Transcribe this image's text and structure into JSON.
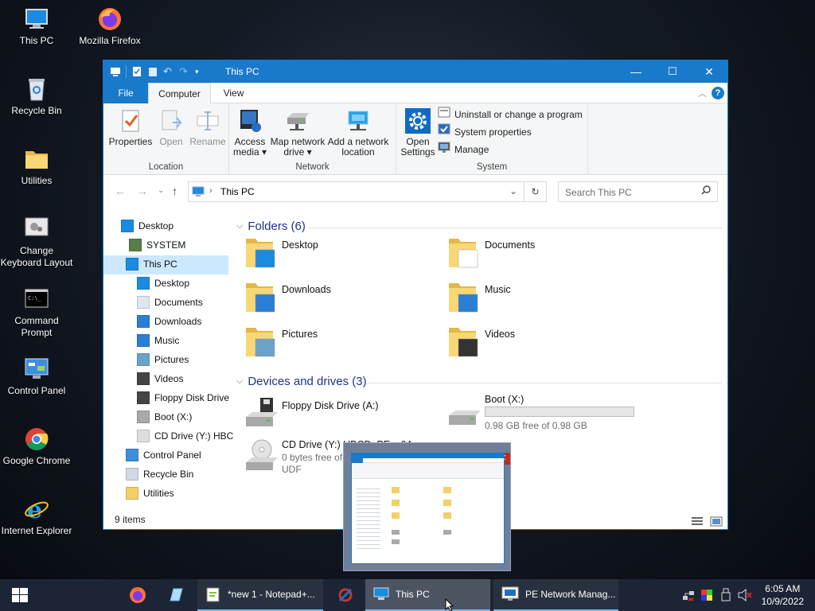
{
  "desktop": {
    "icons": [
      {
        "label": "This PC",
        "icon": "computer-icon"
      },
      {
        "label": "Mozilla Firefox",
        "icon": "firefox-icon"
      },
      {
        "label": "Recycle Bin",
        "icon": "recycle-bin-icon"
      },
      {
        "label": "Utilities",
        "icon": "folder-icon"
      },
      {
        "label": "Change Keyboard Layout",
        "icon": "keyboard-layout-icon"
      },
      {
        "label": "Command Prompt",
        "icon": "cmd-icon"
      },
      {
        "label": "Control Panel",
        "icon": "control-panel-icon"
      },
      {
        "label": "Google Chrome",
        "icon": "chrome-icon"
      },
      {
        "label": "Internet Explorer",
        "icon": "ie-icon"
      }
    ]
  },
  "window": {
    "title": "This PC",
    "controls": {
      "minimize": "—",
      "maximize": "☐",
      "close": "✕"
    },
    "tabs": {
      "file": "File",
      "computer": "Computer",
      "view": "View"
    },
    "ribbon": {
      "location": {
        "name": "Location",
        "properties": "Properties",
        "open": "Open",
        "rename": "Rename"
      },
      "network": {
        "name": "Network",
        "access_media": "Access",
        "access_media_2": "media",
        "map_drive": "Map network",
        "map_drive_2": "drive",
        "add_location": "Add a network",
        "add_location_2": "location"
      },
      "system": {
        "name": "System",
        "open_settings": "Open",
        "open_settings_2": "Settings",
        "uninstall": "Uninstall or change a program",
        "system_properties": "System properties",
        "manage": "Manage"
      }
    },
    "address": {
      "path": "This PC",
      "search_placeholder": "Search This PC"
    },
    "nav_pane": [
      {
        "label": "Desktop",
        "icon": "desktop-icon",
        "indent": 0
      },
      {
        "label": "SYSTEM",
        "icon": "user-icon",
        "indent": 1
      },
      {
        "label": "This PC",
        "icon": "computer-icon",
        "indent": 1
      },
      {
        "label": "Desktop",
        "icon": "desktop-icon",
        "indent": 2
      },
      {
        "label": "Documents",
        "icon": "documents-icon",
        "indent": 2
      },
      {
        "label": "Downloads",
        "icon": "downloads-icon",
        "indent": 2
      },
      {
        "label": "Music",
        "icon": "music-icon",
        "indent": 2
      },
      {
        "label": "Pictures",
        "icon": "pictures-icon",
        "indent": 2
      },
      {
        "label": "Videos",
        "icon": "videos-icon",
        "indent": 2
      },
      {
        "label": "Floppy Disk Drive",
        "icon": "floppy-icon",
        "indent": 2
      },
      {
        "label": "Boot (X:)",
        "icon": "drive-icon",
        "indent": 2
      },
      {
        "label": "CD Drive (Y:) HBC",
        "icon": "cd-icon",
        "indent": 2
      },
      {
        "label": "Control Panel",
        "icon": "control-panel-icon",
        "indent": 1
      },
      {
        "label": "Recycle Bin",
        "icon": "recycle-bin-icon",
        "indent": 1
      },
      {
        "label": "Utilities",
        "icon": "folder-icon",
        "indent": 1
      }
    ],
    "folders_header": "Folders (6)",
    "folders": [
      {
        "label": "Desktop",
        "icon": "desktop-folder-icon"
      },
      {
        "label": "Documents",
        "icon": "documents-folder-icon"
      },
      {
        "label": "Downloads",
        "icon": "downloads-folder-icon"
      },
      {
        "label": "Music",
        "icon": "music-folder-icon"
      },
      {
        "label": "Pictures",
        "icon": "pictures-folder-icon"
      },
      {
        "label": "Videos",
        "icon": "videos-folder-icon"
      }
    ],
    "devices_header": "Devices and drives (3)",
    "devices": {
      "floppy": {
        "label": "Floppy Disk Drive (A:)"
      },
      "boot": {
        "label": "Boot (X:)",
        "free": "0.98 GB free of 0.98 GB",
        "used_fraction": 0.0
      },
      "cd": {
        "label": "CD Drive (Y:) HBCD_PE_x64",
        "free": "0 bytes free of",
        "fs": "UDF"
      }
    },
    "status": "9 items"
  },
  "taskbar": {
    "items": [
      {
        "label": "*new 1 - Notepad+..."
      },
      {
        "label": "This PC"
      },
      {
        "label": "PE Network Manag..."
      }
    ],
    "time": "6:05 AM",
    "date": "10/9/2022"
  },
  "colors": {
    "accent": "#1979ca",
    "taskbar": "#1b2535",
    "folder": "#f3cf69"
  }
}
